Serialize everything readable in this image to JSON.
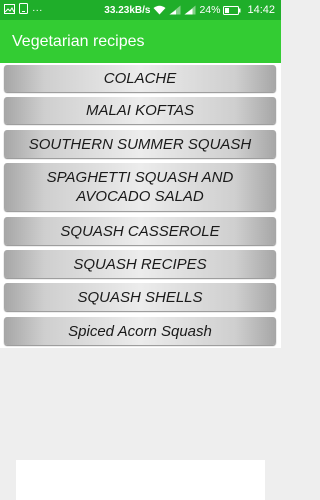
{
  "status_bar": {
    "left_icons": [
      "image-icon",
      "phone-icon",
      "more-icon"
    ],
    "more_glyph": "···",
    "speed": "33.23kB/s",
    "battery_percent": "24%",
    "time": "14:42"
  },
  "app_bar": {
    "title": "Vegetarian recipes"
  },
  "recipes": [
    {
      "label": "COLACHE"
    },
    {
      "label": "MALAI KOFTAS"
    },
    {
      "label": "SOUTHERN SUMMER SQUASH"
    },
    {
      "label": "SPAGHETTI SQUASH AND AVOCADO SALAD"
    },
    {
      "label": "SQUASH CASSEROLE"
    },
    {
      "label": "SQUASH RECIPES"
    },
    {
      "label": "SQUASH SHELLS"
    },
    {
      "label": "Spiced Acorn Squash"
    }
  ],
  "colors": {
    "status_bar": "#1fae2a",
    "app_bar": "#33cc33",
    "background": "#eeeeee"
  }
}
